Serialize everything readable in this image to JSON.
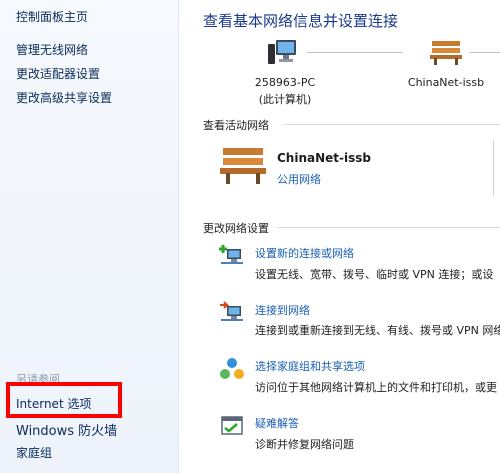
{
  "sidebar": {
    "home_link": "控制面板主页",
    "links": [
      "管理无线网络",
      "更改适配器设置",
      "更改高级共享设置"
    ],
    "see_also_heading": "另请参阅",
    "see_also_links": [
      "Internet 选项",
      "Windows 防火墙",
      "家庭组"
    ]
  },
  "main": {
    "title": "查看基本网络信息并设置连接",
    "map": {
      "computer_name": "258963-PC",
      "computer_caption": "(此计算机)",
      "network_name": "ChinaNet-issb"
    },
    "active_networks": {
      "heading": "查看活动网络",
      "network_name": "ChinaNet-issb",
      "network_type": "公用网络"
    },
    "change_settings": {
      "heading": "更改网络设置",
      "tasks": [
        {
          "icon": "new-connection-icon",
          "link": "设置新的连接或网络",
          "desc": "设置无线、宽带、拨号、临时或 VPN 连接；或设"
        },
        {
          "icon": "connect-network-icon",
          "link": "连接到网络",
          "desc": "连接到或重新连接到无线、有线、拨号或 VPN 网络"
        },
        {
          "icon": "homegroup-icon",
          "link": "选择家庭组和共享选项",
          "desc": "访问位于其他网络计算机上的文件和打印机，或更"
        },
        {
          "icon": "troubleshoot-icon",
          "link": "疑难解答",
          "desc": "诊断并修复网络问题"
        }
      ]
    }
  },
  "colors": {
    "link": "#1a5fb4",
    "title": "#1a3a8c",
    "highlight": "#ff0000"
  }
}
